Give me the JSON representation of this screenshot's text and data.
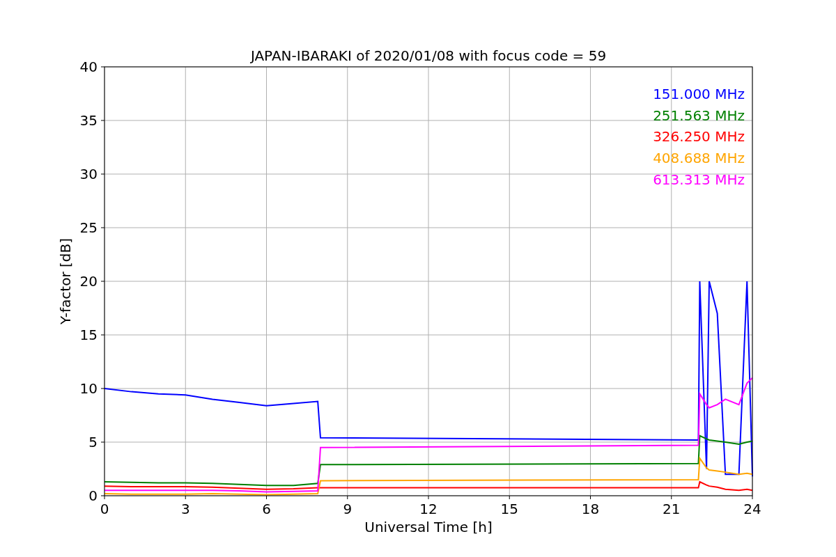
{
  "chart_data": {
    "type": "line",
    "title": "JAPAN-IBARAKI of 2020/01/08 with focus code = 59",
    "xlabel": "Universal Time [h]",
    "ylabel": "Y-factor [dB]",
    "x": [
      0,
      1,
      2,
      3,
      4,
      5,
      6,
      7,
      7.9,
      8,
      22,
      22.05,
      22.3,
      22.4,
      22.7,
      23,
      23.5,
      23.8,
      24
    ],
    "series": [
      {
        "name": "151.000 MHz",
        "color": "#0000ff",
        "values": [
          10,
          9.7,
          9.5,
          9.4,
          9.0,
          8.7,
          8.4,
          8.6,
          8.8,
          5.4,
          5.2,
          20,
          2.5,
          20,
          17,
          2,
          2,
          20,
          1.8
        ]
      },
      {
        "name": "251.563 MHz",
        "color": "#008000",
        "values": [
          1.3,
          1.25,
          1.2,
          1.2,
          1.15,
          1.05,
          0.95,
          0.95,
          1.15,
          2.9,
          3.0,
          5.6,
          5.3,
          5.2,
          5.1,
          5.0,
          4.8,
          5.0,
          5.1
        ]
      },
      {
        "name": "326.250 MHz",
        "color": "#ff0000",
        "values": [
          0.9,
          0.85,
          0.85,
          0.85,
          0.8,
          0.7,
          0.6,
          0.65,
          0.75,
          0.75,
          0.75,
          1.3,
          1.0,
          0.9,
          0.8,
          0.6,
          0.5,
          0.6,
          0.5
        ]
      },
      {
        "name": "408.688 MHz",
        "color": "#ffa500",
        "values": [
          0.2,
          0.15,
          0.15,
          0.15,
          0.2,
          0.15,
          0.1,
          0.15,
          0.2,
          1.4,
          1.5,
          3.5,
          2.6,
          2.4,
          2.3,
          2.2,
          2.0,
          2.1,
          2.0
        ]
      },
      {
        "name": "613.313 MHz",
        "color": "#ff00ff",
        "values": [
          0.5,
          0.5,
          0.5,
          0.5,
          0.5,
          0.45,
          0.35,
          0.4,
          0.45,
          4.5,
          4.7,
          9.5,
          8.5,
          8.2,
          8.5,
          9.0,
          8.5,
          10.5,
          11.0
        ]
      }
    ],
    "grid": true,
    "xlim": [
      0,
      24
    ],
    "ylim": [
      0,
      40
    ],
    "xticks": [
      0,
      3,
      6,
      9,
      12,
      15,
      18,
      21,
      24
    ],
    "yticks": [
      0,
      5,
      10,
      15,
      20,
      25,
      30,
      35,
      40
    ]
  }
}
